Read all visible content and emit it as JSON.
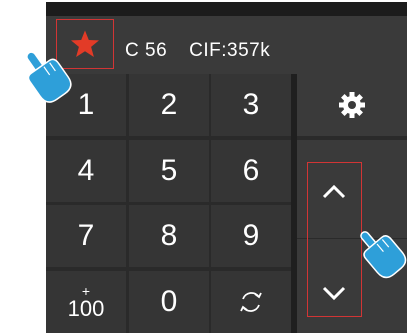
{
  "status": {
    "channel": "C 56",
    "cif": "CIF:357k"
  },
  "keypad": {
    "keys": [
      "1",
      "2",
      "3",
      "4",
      "5",
      "6",
      "7",
      "8",
      "9"
    ],
    "plus_label": "+",
    "hundred_label": "100",
    "zero": "0"
  },
  "icons": {
    "favorite": "star-icon",
    "settings": "gear-icon",
    "swap": "swap-icon",
    "up": "chevron-up-icon",
    "down": "chevron-down-icon",
    "pointer": "hand-pointer-icon"
  },
  "colors": {
    "star": "#e23b27",
    "highlight": "#d23535",
    "hand": "#2e9fd9"
  }
}
